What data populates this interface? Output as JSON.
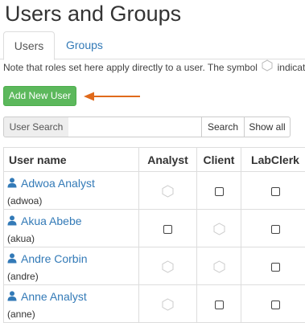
{
  "header": {
    "title": "Users and Groups"
  },
  "tabs": [
    {
      "label": "Users",
      "active": true
    },
    {
      "label": "Groups",
      "active": false
    }
  ],
  "note": {
    "before": "Note that roles set here apply directly to a user. The symbol",
    "after": "indicates",
    "symbol_icon": "hexagon-icon"
  },
  "actions": {
    "add_user_label": "Add New User"
  },
  "annotation": {
    "arrow_color": "#e06a1b"
  },
  "search": {
    "addon_label": "User Search",
    "input_value": "",
    "search_label": "Search",
    "show_all_label": "Show all"
  },
  "table": {
    "columns": [
      "User name",
      "Analyst",
      "Client",
      "LabClerk"
    ],
    "rows": [
      {
        "fullname": "Adwoa Analyst",
        "username": "(adwoa)",
        "roles": [
          "group",
          "checkbox",
          "checkbox"
        ]
      },
      {
        "fullname": "Akua Abebe",
        "username": "(akua)",
        "roles": [
          "checkbox",
          "group",
          "checkbox"
        ]
      },
      {
        "fullname": "Andre Corbin",
        "username": "(andre)",
        "roles": [
          "group",
          "group",
          "checkbox"
        ]
      },
      {
        "fullname": "Anne Analyst",
        "username": "(anne)",
        "roles": [
          "group",
          "checkbox",
          "checkbox"
        ]
      }
    ]
  },
  "colors": {
    "link": "#337ab7",
    "primary_button": "#5cb85c",
    "text": "#333333",
    "border": "#dddddd"
  }
}
